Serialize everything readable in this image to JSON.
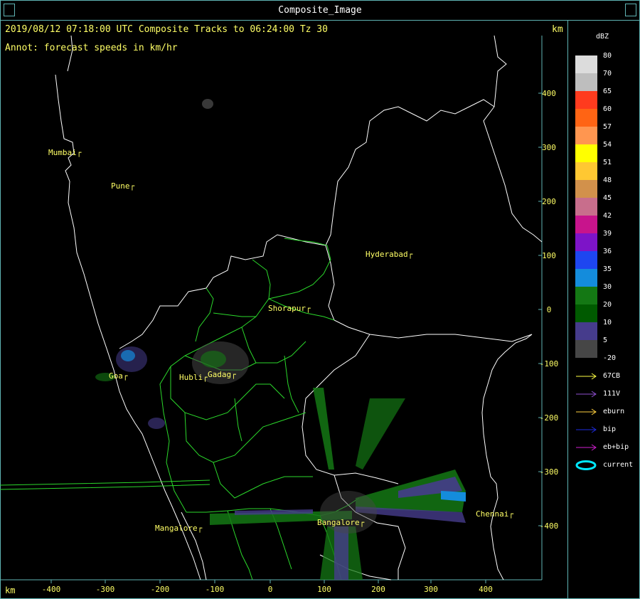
{
  "window": {
    "title": "Composite_Image"
  },
  "header": {
    "line": "2019/08/12 07:18:00 UTC Composite Tracks to 06:24:00 Tz 30",
    "annot": "Annot: forecast speeds in km/hr",
    "unit_right": "km",
    "unit_bottom": "km"
  },
  "axes": {
    "x_ticks": [
      "-400",
      "-300",
      "-200",
      "-100",
      "0",
      "100",
      "200",
      "300",
      "400"
    ],
    "y_ticks": [
      "400",
      "300",
      "200",
      "100",
      "0",
      "-100",
      "-200",
      "-300",
      "-400"
    ]
  },
  "cities": [
    {
      "name": "Mumbai"
    },
    {
      "name": "Pune"
    },
    {
      "name": "Hyderabad"
    },
    {
      "name": "Shorapur"
    },
    {
      "name": "Goa"
    },
    {
      "name": "Hubli"
    },
    {
      "name": "Gadag"
    },
    {
      "name": "Mangalore"
    },
    {
      "name": "Bangalore"
    },
    {
      "name": "Chennai"
    }
  ],
  "legend": {
    "title": "dBZ",
    "levels": [
      {
        "label": "80",
        "color": "#dcdcdc"
      },
      {
        "label": "70",
        "color": "#bebebe"
      },
      {
        "label": "65",
        "color": "#ff3b1e"
      },
      {
        "label": "60",
        "color": "#ff6414"
      },
      {
        "label": "57",
        "color": "#ff9650"
      },
      {
        "label": "54",
        "color": "#ffff00"
      },
      {
        "label": "51",
        "color": "#ffc832"
      },
      {
        "label": "48",
        "color": "#d2914b"
      },
      {
        "label": "45",
        "color": "#c86e8c"
      },
      {
        "label": "42",
        "color": "#c8148c"
      },
      {
        "label": "39",
        "color": "#7d14c8"
      },
      {
        "label": "36",
        "color": "#1e46f0"
      },
      {
        "label": "35",
        "color": "#148cdc"
      },
      {
        "label": "30",
        "color": "#147814"
      },
      {
        "label": "20",
        "color": "#005a00"
      },
      {
        "label": "10",
        "color": "#463c8c"
      },
      {
        "label": "5",
        "color": "#464646"
      },
      {
        "label": "-20",
        "color": "#000000"
      }
    ],
    "tracks": [
      {
        "label": "67CB",
        "color": "#ffff44",
        "kind": "arrow"
      },
      {
        "label": "111V",
        "color": "#9050d0",
        "kind": "arrow"
      },
      {
        "label": "eburn",
        "color": "#ffd040",
        "kind": "arrow"
      },
      {
        "label": "bip",
        "color": "#1e2ce0",
        "kind": "arrow"
      },
      {
        "label": "eb+bip",
        "color": "#d020d0",
        "kind": "arrow"
      },
      {
        "label": "current",
        "color": "#00e8ff",
        "kind": "ellipse"
      }
    ]
  }
}
